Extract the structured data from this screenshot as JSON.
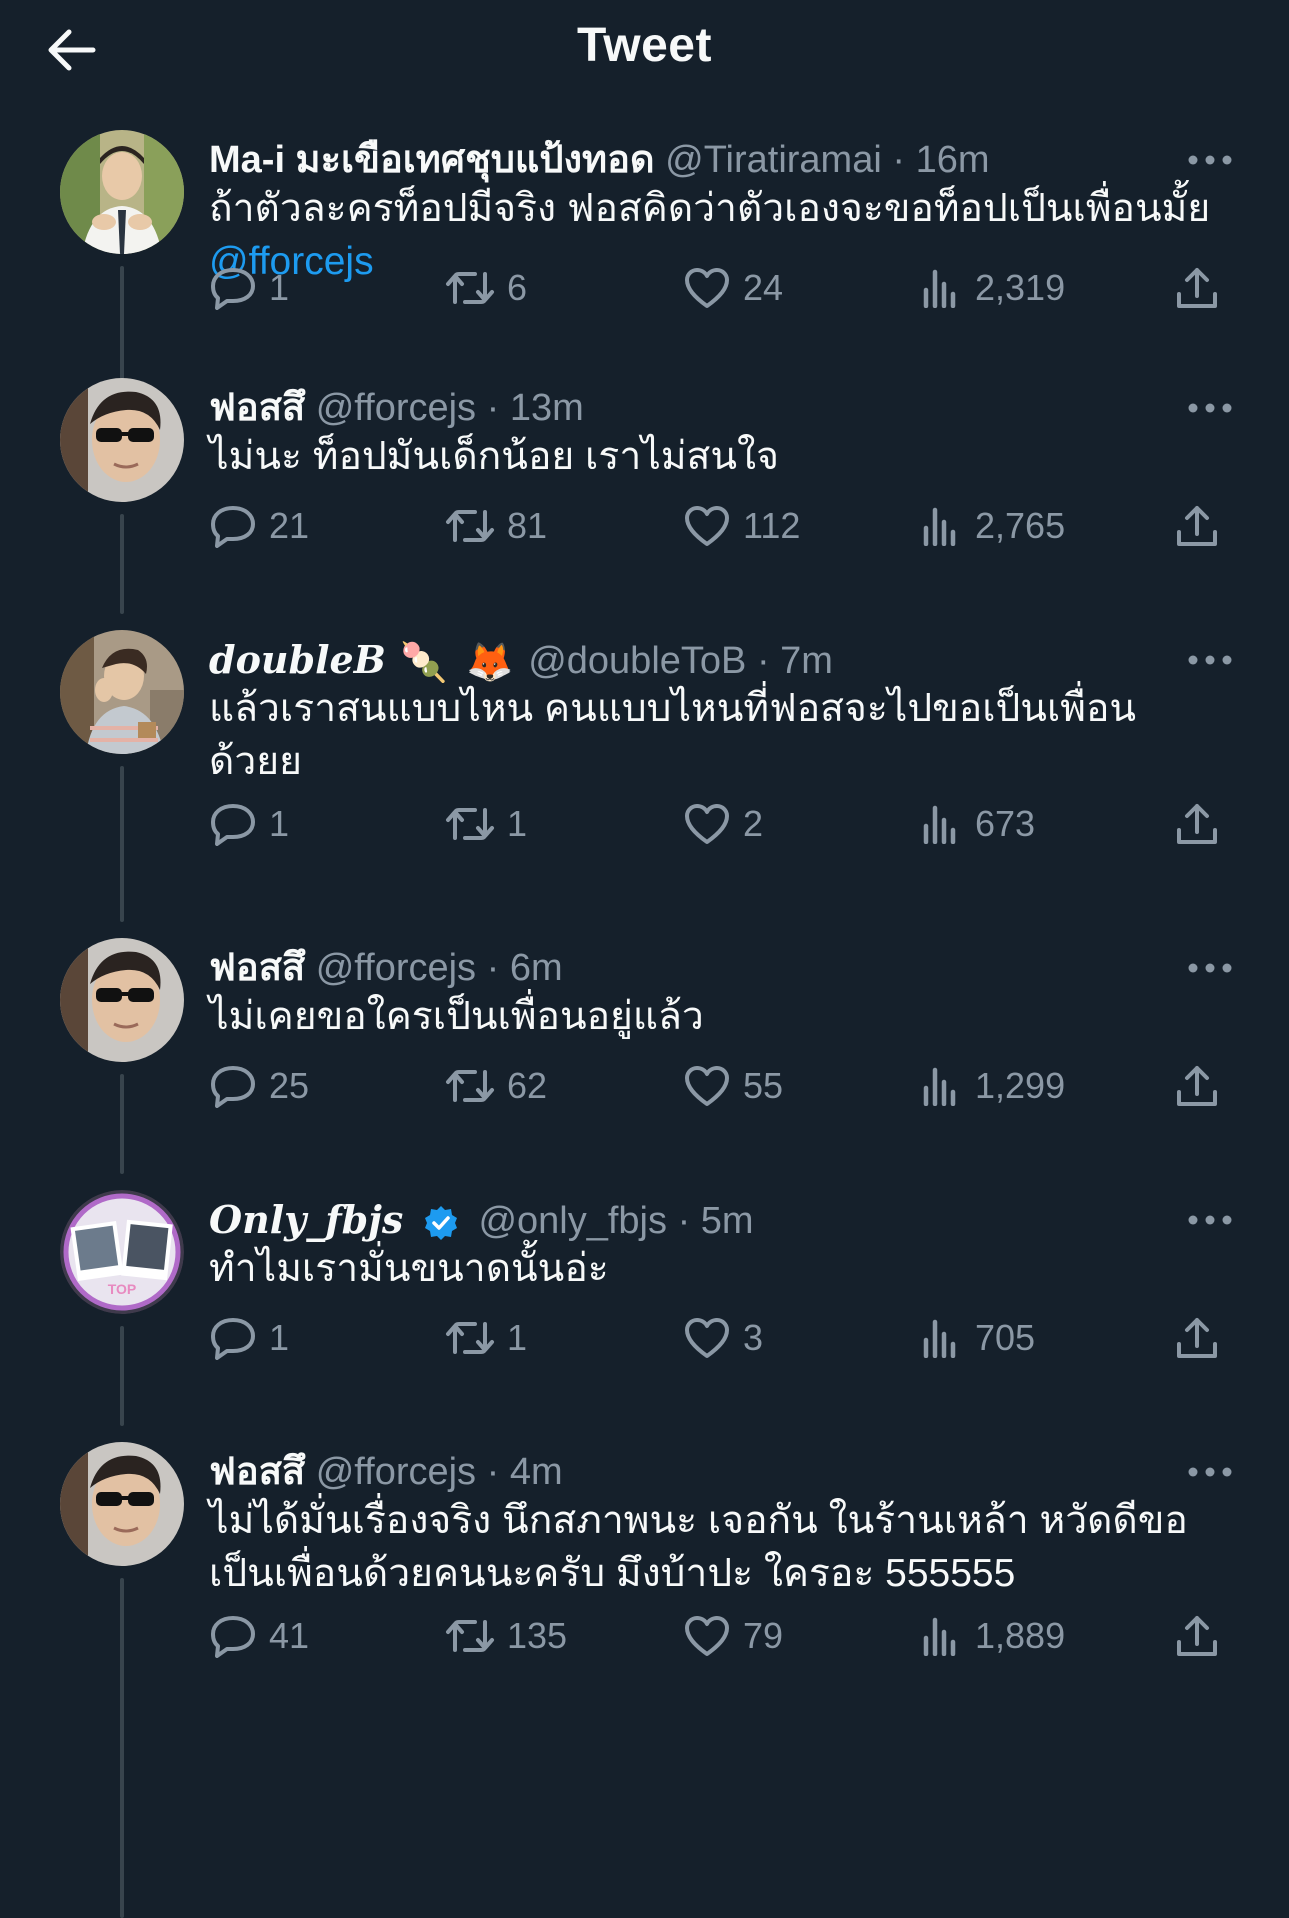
{
  "header": {
    "title": "Tweet"
  },
  "colors": {
    "background": "#15202b",
    "text": "#f7f9f9",
    "muted": "#8b98a5",
    "link": "#1d9bf0",
    "thread_line": "#38444d"
  },
  "icons": {
    "back": "arrow-left-icon",
    "more": "more-horizontal-icon",
    "reply": "reply-icon",
    "retweet": "retweet-icon",
    "like": "heart-icon",
    "views": "views-icon",
    "share": "share-icon",
    "verified": "verified-badge-icon"
  },
  "tweets": [
    {
      "display_name": "Ma-i มะเขือเทศชุบแป้งทอด",
      "handle": "@Tiratiramai",
      "separator": "·",
      "time": "16m",
      "text": "ถ้าตัวละครท็อปมีจริง ฟอสคิดว่าตัวเองจะขอท็อปเป็นเพื่อนมั้ย",
      "mention": "@fforcejs",
      "replies": "1",
      "retweets": "6",
      "likes": "24",
      "views": "2,319"
    },
    {
      "display_name": "ฟอสสึ",
      "handle": "@fforcejs",
      "separator": "·",
      "time": "13m",
      "text": "ไม่นะ ท็อปมันเด็กน้อย เราไม่สนใจ",
      "replies": "21",
      "retweets": "81",
      "likes": "112",
      "views": "2,765"
    },
    {
      "display_name": "doubleB",
      "emojis": [
        "🍡",
        "🦊"
      ],
      "handle": "@doubleToB",
      "separator": "·",
      "time": "7m",
      "text_line1": "แล้วเราสนแบบไหน คนแบบไหนที่ฟอสจะไปขอเป็นเพื่อน",
      "text_line2": "ด้วยย",
      "replies": "1",
      "retweets": "1",
      "likes": "2",
      "views": "673"
    },
    {
      "display_name": "ฟอสสึ",
      "handle": "@fforcejs",
      "separator": "·",
      "time": "6m",
      "text": "ไม่เคยขอใครเป็นเพื่อนอยู่แล้ว",
      "replies": "25",
      "retweets": "62",
      "likes": "55",
      "views": "1,299"
    },
    {
      "display_name": "Only_fbjs",
      "verified": true,
      "handle": "@only_fbjs",
      "separator": "·",
      "time": "5m",
      "text": "ทำไมเรามั่นขนาดนั้นอ่ะ",
      "avatar_text": "TOP",
      "replies": "1",
      "retweets": "1",
      "likes": "3",
      "views": "705"
    },
    {
      "display_name": "ฟอสสึ",
      "handle": "@fforcejs",
      "separator": "·",
      "time": "4m",
      "text_line1": "ไม่ได้มั่นเรื่องจริง นึกสภาพนะ เจอกัน ในร้านเหล้า หวัดดีขอ",
      "text_line2": "เป็นเพื่อนด้วยคนนะครับ มึงบ้าปะ ใครอะ 555555",
      "replies": "41",
      "retweets": "135",
      "likes": "79",
      "views": "1,889"
    }
  ]
}
